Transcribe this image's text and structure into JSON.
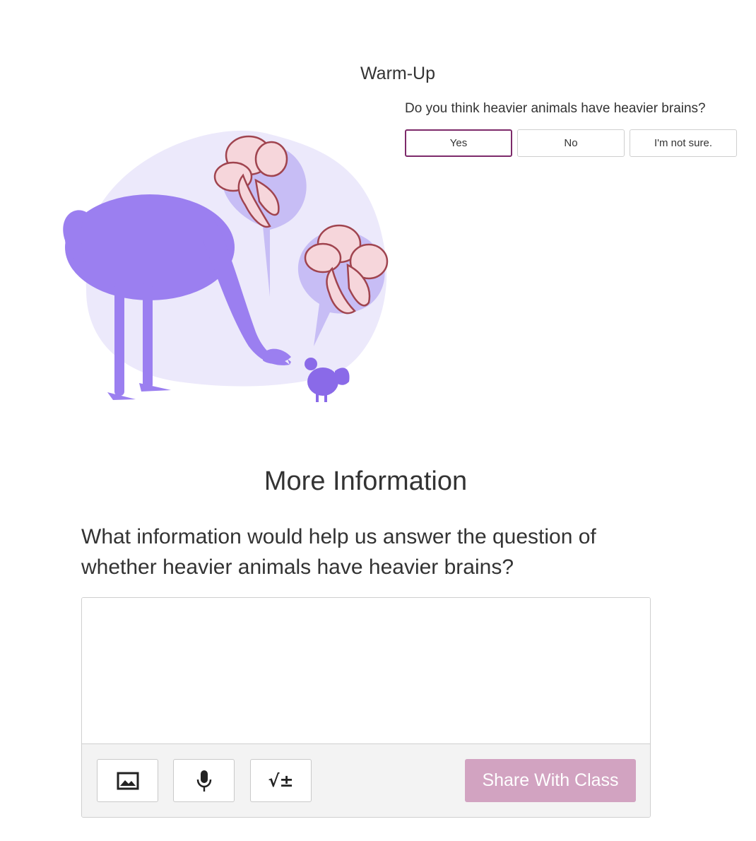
{
  "warmup": {
    "title": "Warm-Up",
    "question": "Do you think heavier animals have heavier brains?",
    "choices": [
      "Yes",
      "No",
      "I'm not sure."
    ],
    "selected": "Yes"
  },
  "illustration": {
    "subject": "ostrich and rooster with brain thought bubbles",
    "colors": {
      "blob": "#ece9fb",
      "animals": "#9b7ff0",
      "bubbles": "#c7bdf5",
      "brain_fill": "#f6d6db",
      "brain_stroke": "#a0444f"
    }
  },
  "more_info": {
    "title": "More Information",
    "prompt": "What information would help us answer the question of whether heavier animals have heavier brains?",
    "response_value": "",
    "toolbar": {
      "image_icon": "image-icon",
      "mic_icon": "microphone-icon",
      "math_icon": "math-sqrt-icon",
      "math_glyph": "√±",
      "share_label": "Share With Class"
    },
    "colors": {
      "share_bg": "#d2a3c1",
      "selected_border": "#7d2a6a"
    }
  }
}
